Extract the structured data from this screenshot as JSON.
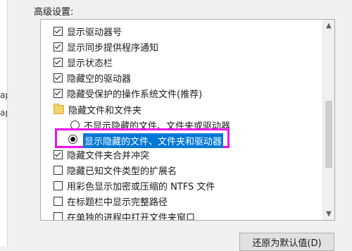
{
  "section_label": "高级设置:",
  "edge_text": [
    "ap",
    "ap"
  ],
  "items": [
    {
      "label": "显示驱动器号",
      "type": "checkbox",
      "checked": true
    },
    {
      "label": "显示同步提供程序通知",
      "type": "checkbox",
      "checked": true
    },
    {
      "label": "显示状态栏",
      "type": "checkbox",
      "checked": true
    },
    {
      "label": "隐藏空的驱动器",
      "type": "checkbox",
      "checked": true
    },
    {
      "label": "隐藏受保护的操作系统文件(推荐)",
      "type": "checkbox",
      "checked": true
    },
    {
      "label": "隐藏文件和文件夹",
      "type": "folder"
    },
    {
      "label": "不显示隐藏的文件、文件夹或驱动器",
      "type": "radio",
      "checked": false
    },
    {
      "label": "显示隐藏的文件、文件夹和驱动器",
      "type": "radio",
      "checked": true
    },
    {
      "label": "隐藏文件夹合并冲突",
      "type": "checkbox",
      "checked": true
    },
    {
      "label": "隐藏已知文件类型的扩展名",
      "type": "checkbox",
      "checked": false
    },
    {
      "label": "用彩色显示加密或压缩的 NTFS 文件",
      "type": "checkbox",
      "checked": false
    },
    {
      "label": "在标题栏中显示完整路径",
      "type": "checkbox",
      "checked": false
    },
    {
      "label": "在单独的进程中打开文件夹窗口",
      "type": "checkbox",
      "checked": false
    }
  ],
  "restore_button_label": "还原为默认值(D)",
  "colors": {
    "highlight_border": "#ee10ee",
    "selection": "#0078d7"
  }
}
